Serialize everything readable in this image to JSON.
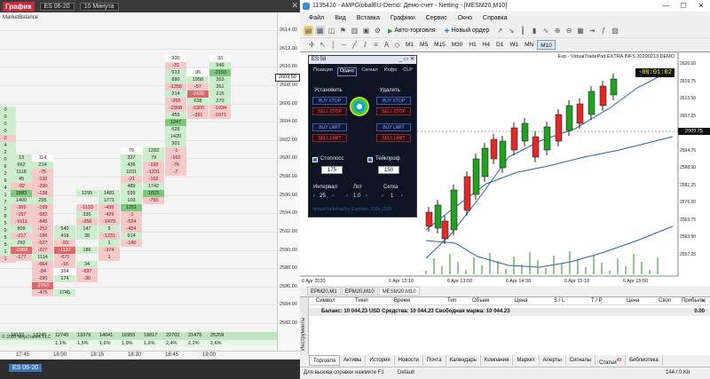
{
  "left": {
    "title": "График",
    "symbol": "ES 06-20",
    "interval": "10 Минута",
    "indicator": "MarketBalance",
    "bottom_tab": "ES 06-20",
    "price_marker": "2609.50",
    "copyright": "© 2020 NinjaTrader, LLC",
    "y_ticks": [
      "2614.00",
      "2612.00",
      "2610.00",
      "2608.00",
      "2606.00",
      "2604.00",
      "2602.00",
      "2600.00",
      "2598.00",
      "2596.00",
      "2594.00",
      "2592.00",
      "2590.00",
      "2588.00",
      "2586.00",
      "2584.00",
      "2582.00"
    ],
    "x_ticks": [
      "17:45",
      "18:00",
      "18:15",
      "18:30",
      "18:45",
      "19:00"
    ],
    "volumes": [
      "18193",
      "13245",
      "12745",
      "13379",
      "14041",
      "16955",
      "18817",
      "22702",
      "21475",
      "25259"
    ],
    "percents": [
      "1,1%",
      "1,5%",
      "1,6%",
      "1,9%",
      "1,6%",
      "2,4%",
      "2,2%",
      "2,6%"
    ],
    "columns": [
      {
        "cells": [
          [
            "0",
            120,
            "g"
          ],
          [
            "0",
            128,
            "g"
          ],
          [
            "0",
            136,
            "g"
          ],
          [
            "0",
            144,
            "g"
          ],
          [
            "0",
            152,
            "r"
          ],
          [
            "4",
            160,
            "g"
          ],
          [
            "2",
            168,
            "g"
          ],
          [
            "0",
            176,
            "g"
          ],
          [
            "6",
            184,
            "g"
          ],
          [
            "2",
            192,
            "g"
          ],
          [
            "6",
            200,
            "g"
          ],
          [
            "4",
            208,
            "g"
          ],
          [
            "1",
            216,
            "g"
          ],
          [
            "7",
            224,
            "g"
          ],
          [
            "2",
            232,
            "g"
          ],
          [
            "8",
            240,
            "g"
          ],
          [
            "5",
            248,
            "g"
          ],
          [
            "9",
            256,
            "g"
          ],
          [
            "5",
            264,
            "g"
          ],
          [
            "5",
            272,
            "g"
          ],
          [
            "1",
            280,
            "g"
          ],
          [
            "1",
            288,
            "r"
          ]
        ]
      },
      {
        "cells": [
          [
            "13",
            174,
            "g"
          ],
          [
            "662",
            182,
            "g"
          ],
          [
            "1118",
            190,
            "g"
          ],
          [
            "45",
            198,
            "g"
          ],
          [
            "-92",
            206,
            "r"
          ],
          [
            "1883",
            214,
            "gg"
          ],
          [
            "1400",
            222,
            "g"
          ],
          [
            "-366",
            230,
            "r"
          ],
          [
            "-157",
            238,
            "r"
          ],
          [
            "-1511",
            246,
            "r"
          ],
          [
            "809",
            254,
            "g"
          ],
          [
            "-217",
            262,
            "r"
          ],
          [
            "292",
            270,
            "g"
          ],
          [
            "-2968",
            278,
            "rr"
          ],
          [
            "-177",
            286,
            "r"
          ]
        ]
      },
      {
        "cells": [
          [
            "114",
            174,
            "w"
          ],
          [
            "214",
            182,
            "g"
          ],
          [
            "-75",
            190,
            "r"
          ],
          [
            "-132",
            198,
            "r"
          ],
          [
            "-290",
            206,
            "r"
          ],
          [
            "-138",
            214,
            "r"
          ],
          [
            "295",
            222,
            "g"
          ],
          [
            "-199",
            230,
            "r"
          ],
          [
            "-582",
            238,
            "r"
          ],
          [
            "-845",
            246,
            "r"
          ],
          [
            "-252",
            254,
            "r"
          ],
          [
            "-186",
            262,
            "r"
          ],
          [
            "-527",
            270,
            "r"
          ],
          [
            "-227",
            278,
            "r"
          ],
          [
            "1114",
            286,
            "g"
          ],
          [
            "-664",
            294,
            "r"
          ],
          [
            "-84",
            302,
            "r"
          ],
          [
            "-290",
            310,
            "r"
          ],
          [
            "-2763",
            318,
            "rr"
          ],
          [
            "-475",
            326,
            "r"
          ]
        ]
      },
      {
        "cells": [
          [
            "540",
            254,
            "g"
          ],
          [
            "418",
            262,
            "g"
          ],
          [
            "-93",
            270,
            "r"
          ],
          [
            "-1137",
            278,
            "rr"
          ],
          [
            "-671",
            286,
            "r"
          ],
          [
            "-16",
            294,
            "r"
          ],
          [
            "354",
            302,
            "w"
          ],
          [
            "174",
            310,
            "g"
          ],
          [
            "1745",
            326,
            "g"
          ]
        ]
      },
      {
        "cells": [
          [
            "1295",
            214,
            "g"
          ],
          [
            "-1133",
            230,
            "r"
          ],
          [
            "336",
            238,
            "g"
          ],
          [
            "-256",
            246,
            "r"
          ],
          [
            "147",
            254,
            "g"
          ],
          [
            "38",
            262,
            "g"
          ],
          [
            "186",
            278,
            "g"
          ],
          [
            "34",
            294,
            "g"
          ],
          [
            "-697",
            302,
            "r"
          ],
          [
            "-30",
            310,
            "r"
          ]
        ]
      },
      {
        "cells": [
          [
            "1481",
            214,
            "g"
          ],
          [
            "1771",
            222,
            "g"
          ],
          [
            "-435",
            230,
            "r"
          ],
          [
            "-429",
            238,
            "r"
          ],
          [
            "-1479",
            246,
            "r"
          ],
          [
            "5",
            254,
            "g"
          ],
          [
            "-1231",
            262,
            "r"
          ],
          [
            "1",
            270,
            "g"
          ],
          [
            "-374",
            278,
            "r"
          ],
          [
            "1",
            286,
            "r"
          ]
        ]
      },
      {
        "cells": [
          [
            "79",
            166,
            "w"
          ],
          [
            "327",
            174,
            "g"
          ],
          [
            "436",
            182,
            "g"
          ],
          [
            "1031",
            190,
            "g"
          ],
          [
            "-21",
            198,
            "r"
          ],
          [
            "489",
            206,
            "g"
          ],
          [
            "599",
            214,
            "g"
          ],
          [
            "103",
            222,
            "g"
          ],
          [
            "1251",
            230,
            "gg"
          ],
          [
            "-1",
            238,
            "r"
          ],
          [
            "-524",
            246,
            "r"
          ],
          [
            "-454",
            254,
            "r"
          ],
          [
            "914",
            262,
            "g"
          ],
          [
            "-140",
            270,
            "r"
          ]
        ]
      },
      {
        "cells": [
          [
            "1283",
            166,
            "g"
          ],
          [
            "79",
            174,
            "g"
          ],
          [
            "-193",
            182,
            "r"
          ],
          [
            "-1231",
            190,
            "r"
          ],
          [
            "-162",
            198,
            "r"
          ],
          [
            "1742",
            206,
            "g"
          ],
          [
            "1823",
            214,
            "gg"
          ],
          [
            "-755",
            222,
            "r"
          ]
        ]
      },
      {
        "cells": [
          [
            "25",
            158,
            "g"
          ],
          [
            "1420",
            150,
            "g"
          ],
          [
            "-1",
            166,
            "r"
          ],
          [
            "-162",
            174,
            "r"
          ],
          [
            "-76",
            182,
            "r"
          ],
          [
            "-7",
            190,
            "r"
          ],
          [
            "1247",
            134,
            "gg"
          ],
          [
            "628",
            142,
            "g"
          ],
          [
            "301",
            158,
            "g"
          ],
          [
            "455",
            126,
            "g"
          ],
          [
            "-2908",
            118,
            "r"
          ],
          [
            "300",
            62,
            "w"
          ],
          [
            "-31",
            70,
            "r"
          ],
          [
            "880",
            86,
            "g"
          ],
          [
            "913",
            78,
            "g"
          ],
          [
            "-1356",
            94,
            "r"
          ],
          [
            "214",
            102,
            "g"
          ],
          [
            "-266",
            110,
            "r"
          ]
        ]
      },
      {
        "cells": [
          [
            "95",
            78,
            "w"
          ],
          [
            "1958",
            86,
            "g"
          ],
          [
            "-57",
            94,
            "r"
          ],
          [
            "-2436",
            102,
            "rr"
          ],
          [
            "638",
            110,
            "g"
          ],
          [
            "-3300",
            118,
            "r"
          ],
          [
            "-391",
            126,
            "r"
          ]
        ]
      },
      {
        "cells": [
          [
            "33",
            62,
            "w"
          ],
          [
            "946",
            70,
            "g"
          ],
          [
            "-2193",
            78,
            "gg"
          ],
          [
            "353",
            86,
            "g"
          ],
          [
            "361",
            94,
            "g"
          ],
          [
            "215",
            102,
            "g"
          ],
          [
            "270",
            110,
            "g"
          ],
          [
            "-1034",
            118,
            "r"
          ],
          [
            "-1071",
            126,
            "r"
          ]
        ]
      }
    ]
  },
  "right": {
    "window_title": "1135410 - AMPGlobalEU-Demo: Демо-счет - Netting - [MESM20,M10]",
    "menu": [
      "Файл",
      "Вид",
      "Вставка",
      "Графики",
      "Сервис",
      "Окно",
      "Справка"
    ],
    "toolbar": {
      "algo_trading": "Авто-торговля",
      "new_order": "Новый ордер"
    },
    "timeframes": [
      "M1",
      "M5",
      "M15",
      "M30",
      "H1",
      "H4",
      "D1",
      "W1",
      "MN"
    ],
    "active_tf": "M10",
    "symbol_label": "Exp - VirtualTradePad EXTRA INFS 20200213 DEMO",
    "timer": "-00:01:02",
    "current_price": "2609.75",
    "price_ticks": [
      "2626.00",
      "2619.75",
      "2613.50",
      "2607.25",
      "2601.00",
      "2594.75",
      "2588.50",
      "2582.25",
      "2576.00",
      "2569.75",
      "2563.50",
      "2557.25"
    ],
    "time_ticks": [
      "6 Apr 2020",
      "6 Apr 13:10",
      "6 Apr 13:50",
      "6 Apr 14:30",
      "6 Apr 15:10",
      "6 Apr 15:50"
    ],
    "chart_tabs": [
      "EPM20,M1",
      "EPM20,M10",
      "MESM20,M10"
    ],
    "active_chart_tab": "MESM20,M10",
    "panel": {
      "title": "ES:58",
      "tabs": [
        "Позиция",
        "Ордер",
        "Сигнал",
        "Инфо",
        "CLP"
      ],
      "active_tab": "Ордер",
      "set_label": "Установить",
      "delete_label": "Удалить",
      "buy_stop": "BUY STOP",
      "sell_stop": "SELL STOP",
      "buy_limit": "BUY LIMIT",
      "sell_limit": "SELL LIMIT",
      "stoploss_label": "Стоплосс",
      "stoploss_value": "175",
      "takeprofit_label": "Тейкпроф",
      "takeprofit_value": "150",
      "interval_label": "Интервал",
      "interval_value": "25",
      "lot_label": "Лот",
      "lot_value": "1.0",
      "grid_label": "Сетка",
      "grid_value": "1",
      "footer": "VirtualTradePad by Expforex 2009-2020"
    },
    "terminal": {
      "side_label": "Инструменты",
      "columns": [
        "Символ",
        "Тикет",
        "Время",
        "Тип",
        "Объем",
        "Цена",
        "S / L",
        "T / P",
        "Цена",
        "Своп",
        "Прибыль"
      ],
      "balance": "Баланс: 10 044.23 USD  Средства: 10 044.23  Свободная маржа: 10 044.23",
      "total": "0.00"
    },
    "bottom_tabs": [
      "Торговля",
      "Активы",
      "История",
      "Новости",
      "Почта",
      "Календарь",
      "Компания",
      "Маркет",
      "Алерты",
      "Сигналы",
      "Статьи",
      "Библиотека"
    ],
    "active_bottom_tab": "Торговля",
    "articles_badge": "49",
    "status_help": "Для вызова справки нажмите F1",
    "status_profile": "Default",
    "status_traffic": "144 / 0 Kb"
  }
}
